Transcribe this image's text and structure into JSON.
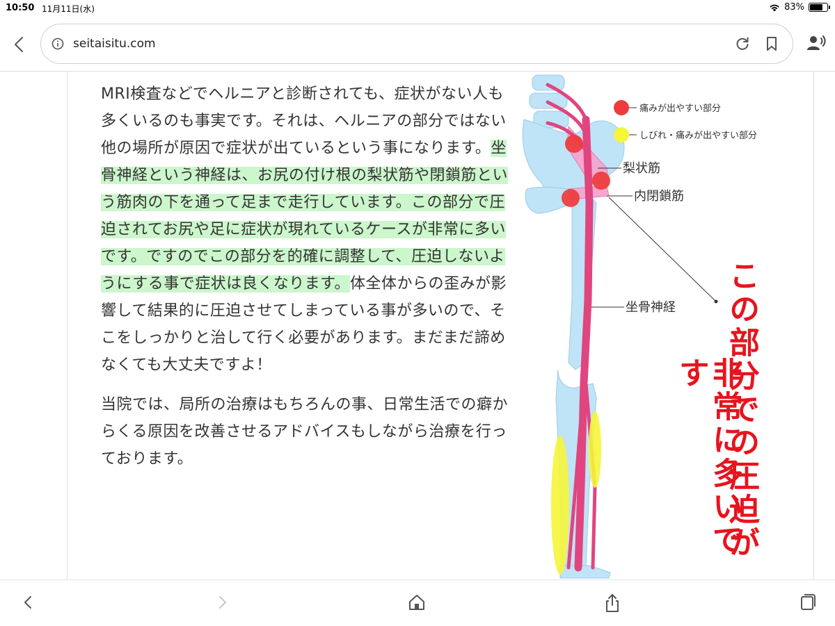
{
  "status": {
    "time": "10:50",
    "date": "11月11日(水)",
    "battery": "83%",
    "battery_level": 0.83
  },
  "toolbar": {
    "url": "seitaisitu.com"
  },
  "article": {
    "p1_plain1": "MRI検査などでヘルニアと診断されても、症状がない人も多くいるのも事実です。それは、ヘルニアの部分ではない他の場所が原因で症状が出ているという事になります。",
    "p1_highlight": "坐骨神経という神経は、お尻の付け根の梨状筋や閉鎖筋という筋肉の下を通って足まで走行しています。この部分で圧迫されてお尻や足に症状が現れているケースが非常に多いです。ですのでこの部分を的確に調整して、圧迫しないようにする事で症状は良くなります。",
    "p1_plain2": "体全体からの歪みが影響して結果的に圧迫させてしまっている事が多いので、そこをしっかりと治して行く必要があります。まだまだ諦めなくても大丈夫ですよ！",
    "p2": "当院では、局所の治療はもちろんの事、日常生活での癖からくる原因を改善させるアドバイスもしながら治療を行っております。"
  },
  "illustration": {
    "legend_red": "痛みが出やすい部分",
    "legend_yellow": "しびれ・痛みが出やすい部分",
    "label_piriformis": "梨状筋",
    "label_obturator": "内閉鎖筋",
    "label_sciatic": "坐骨神経",
    "callout_col1": "この部分での圧迫が",
    "callout_col2": "非常に多いです",
    "colors": {
      "red": "#ee3b3b",
      "yellow": "#f5f53a",
      "bone": "#bfe3f7",
      "nerve": "#e0457f",
      "muscle": "#f3a8cf",
      "callout": "#e6141e"
    }
  },
  "icons": [
    "info-icon",
    "reload-icon",
    "bookmark-icon",
    "reader-icon",
    "back-icon",
    "forward-icon",
    "home-icon",
    "share-icon",
    "tabs-icon"
  ]
}
